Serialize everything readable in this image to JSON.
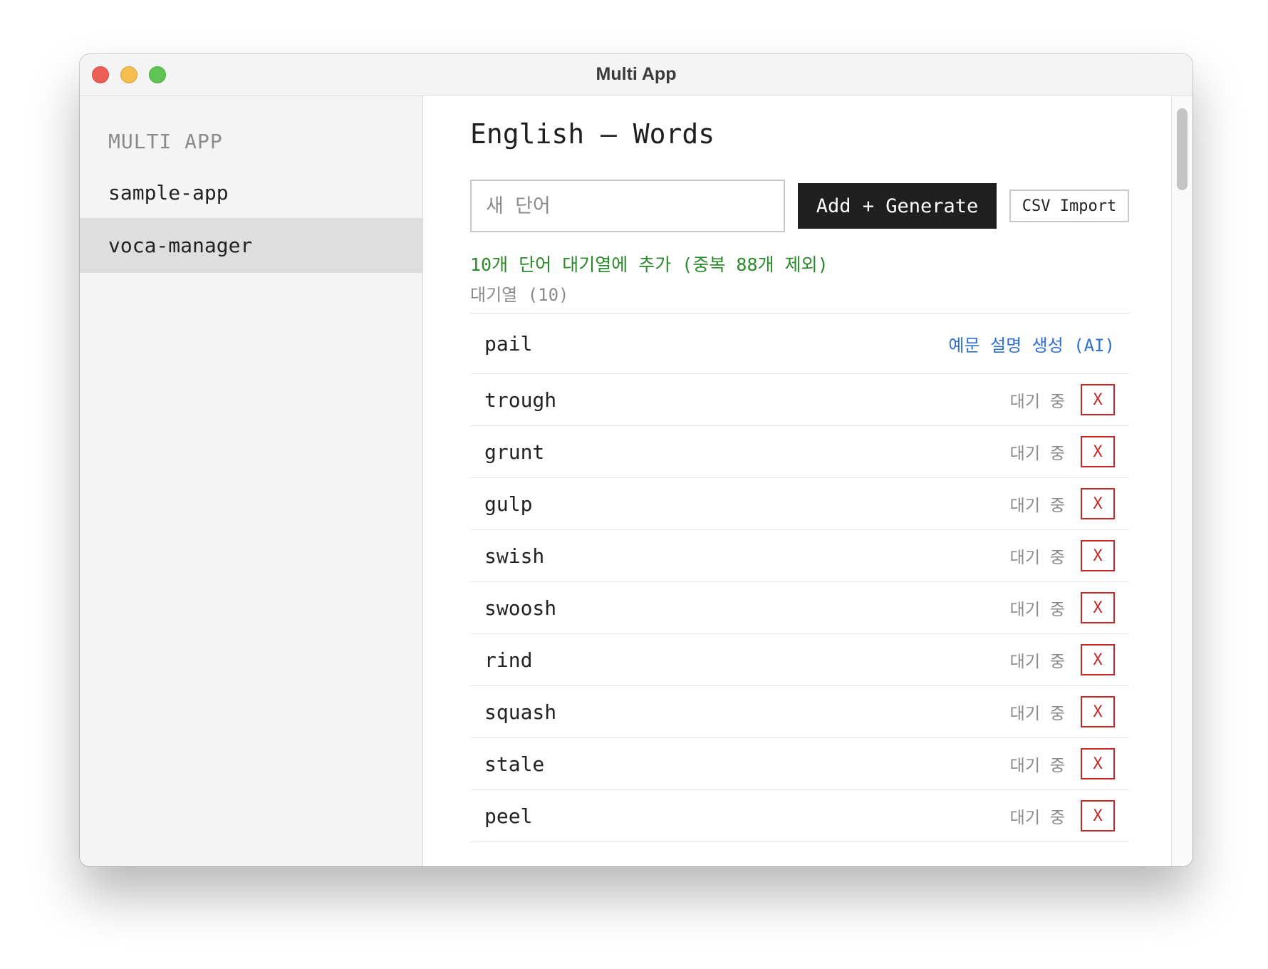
{
  "window": {
    "title": "Multi App"
  },
  "sidebar": {
    "heading": "MULTI APP",
    "items": [
      {
        "label": "sample-app",
        "active": false
      },
      {
        "label": "voca-manager",
        "active": true
      }
    ]
  },
  "main": {
    "title": "English — Words",
    "input": {
      "placeholder": "새 단어",
      "value": ""
    },
    "generate_button": "Add + Generate",
    "csv_button": "CSV Import",
    "status_message": "10개 단어 대기열에 추가 (중복 88개 제외)",
    "queue_heading": "대기열 (10)",
    "words": [
      {
        "word": "pail",
        "action": "예문 설명 생성 (AI)"
      },
      {
        "word": "trough",
        "status": "대기 중",
        "remove": "X"
      },
      {
        "word": "grunt",
        "status": "대기 중",
        "remove": "X"
      },
      {
        "word": "gulp",
        "status": "대기 중",
        "remove": "X"
      },
      {
        "word": "swish",
        "status": "대기 중",
        "remove": "X"
      },
      {
        "word": "swoosh",
        "status": "대기 중",
        "remove": "X"
      },
      {
        "word": "rind",
        "status": "대기 중",
        "remove": "X"
      },
      {
        "word": "squash",
        "status": "대기 중",
        "remove": "X"
      },
      {
        "word": "stale",
        "status": "대기 중",
        "remove": "X"
      },
      {
        "word": "peel",
        "status": "대기 중",
        "remove": "X"
      }
    ]
  },
  "colors": {
    "accent_dark": "#1f1f1f",
    "success_green": "#2a8a2a",
    "link_blue": "#2f6fd6",
    "danger_red": "#c62828",
    "muted_gray": "#8a8a8a"
  }
}
